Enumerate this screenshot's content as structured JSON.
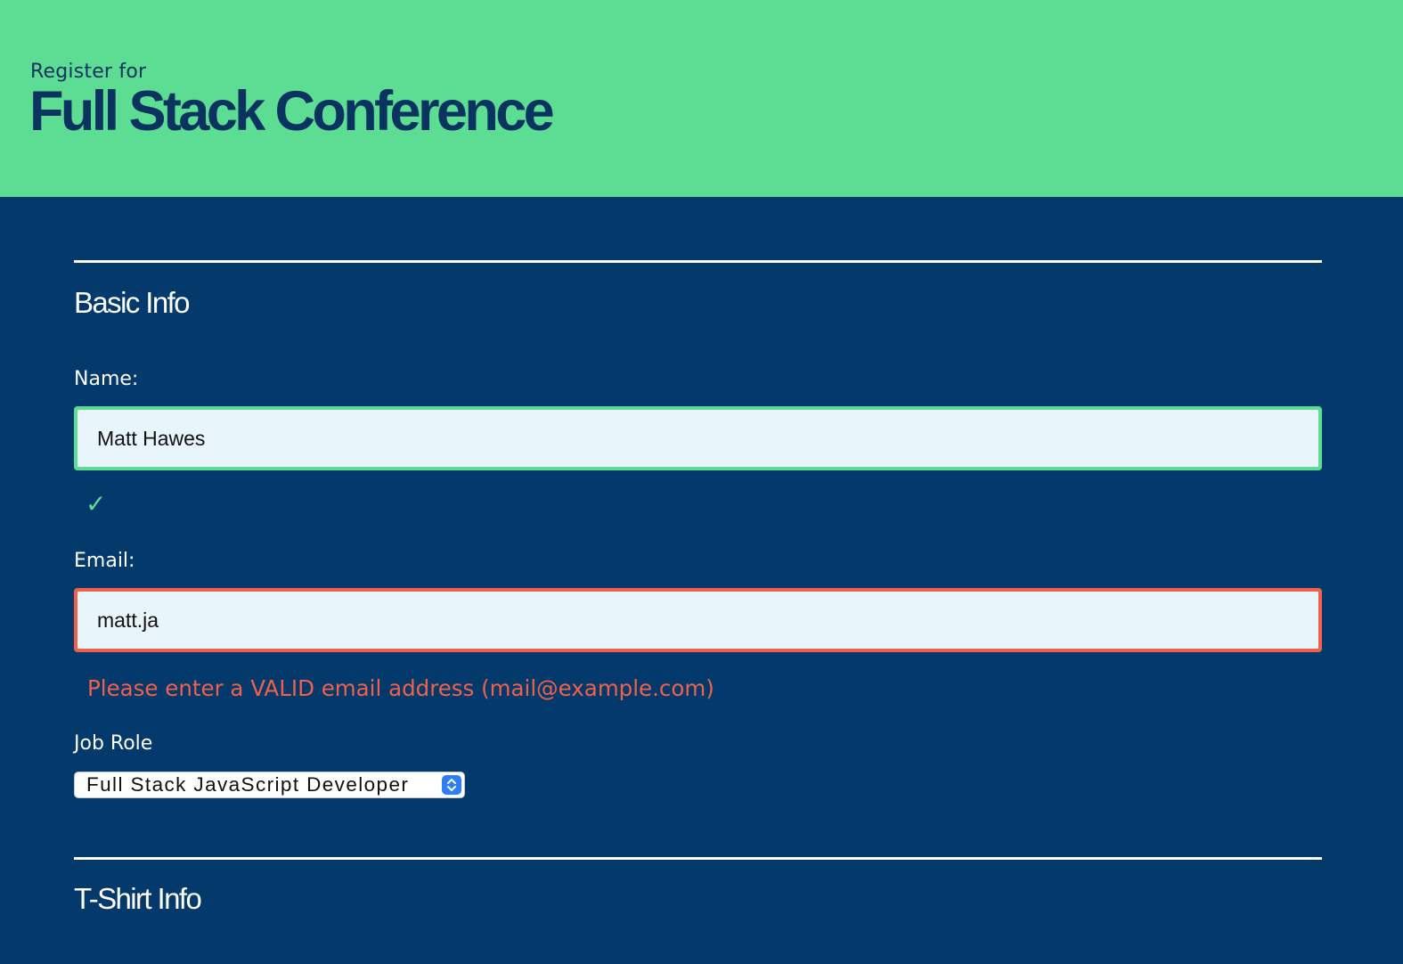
{
  "header": {
    "subtitle": "Register for",
    "title": "Full Stack Conference"
  },
  "basic_info": {
    "heading": "Basic Info",
    "name": {
      "label": "Name:",
      "value": "Matt Hawes",
      "status": "valid",
      "status_icon": "check-icon",
      "status_glyph": "✓"
    },
    "email": {
      "label": "Email:",
      "value": "matt.ja",
      "status": "invalid",
      "error": "Please enter a VALID email address (mail@example.com)"
    },
    "job_role": {
      "label": "Job Role",
      "selected": "Full Stack JavaScript Developer"
    }
  },
  "tshirt_info": {
    "heading": "T-Shirt Info"
  },
  "colors": {
    "header_bg": "#5ddd94",
    "page_bg": "#04396c",
    "title_text": "#0b3360",
    "valid": "#5ddd94",
    "invalid": "#f0604a",
    "input_bg": "#e8f5fb",
    "select_arrow": "#2f7ef4"
  }
}
